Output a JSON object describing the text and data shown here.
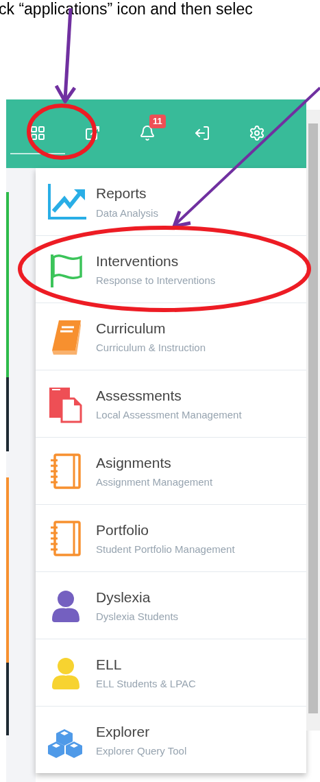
{
  "instruction": "ck “applications” icon and then selec",
  "toolbar": [
    {
      "kind": "apps",
      "selected": true
    },
    {
      "kind": "external",
      "selected": false
    },
    {
      "kind": "bell",
      "selected": false,
      "badge": "11"
    },
    {
      "kind": "exit",
      "selected": false
    },
    {
      "kind": "settings",
      "selected": false
    }
  ],
  "menu": [
    {
      "kind": "chart",
      "color": "#29aee6",
      "title": "Reports",
      "subtitle": "Data Analysis"
    },
    {
      "kind": "flag",
      "color": "#3cc45a",
      "title": "Interventions",
      "subtitle": "Response to Interventions"
    },
    {
      "kind": "book",
      "color": "#f7902f",
      "title": "Curriculum",
      "subtitle": "Curriculum & Instruction"
    },
    {
      "kind": "documents",
      "color": "#ee4f55",
      "title": "Assessments",
      "subtitle": "Local Assessment Management"
    },
    {
      "kind": "notebook",
      "color": "#f7902f",
      "title": "Asignments",
      "subtitle": "Assignment Management"
    },
    {
      "kind": "notebook",
      "color": "#f7902f",
      "title": "Portfolio",
      "subtitle": "Student Portfolio Management"
    },
    {
      "kind": "person",
      "color": "#7460c0",
      "title": "Dyslexia",
      "subtitle": "Dyslexia Students"
    },
    {
      "kind": "person",
      "color": "#f7d330",
      "title": "ELL",
      "subtitle": "ELL Students & LPAC"
    },
    {
      "kind": "cubes",
      "color": "#4f9ae8",
      "title": "Explorer",
      "subtitle": "Explorer Query Tool"
    }
  ]
}
